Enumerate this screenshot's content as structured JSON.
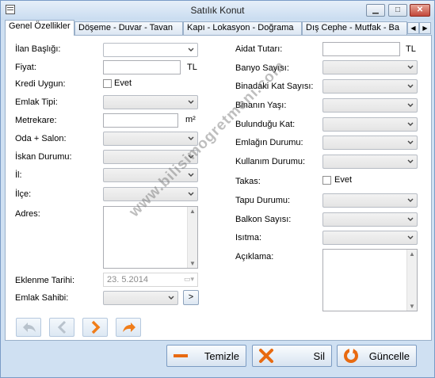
{
  "window": {
    "title": "Satılık Konut"
  },
  "tabs": [
    {
      "label": "Genel Özellikler"
    },
    {
      "label": "Döşeme - Duvar - Tavan"
    },
    {
      "label": "Kapı - Lokasyon - Doğrama"
    },
    {
      "label": "Dış Cephe - Mutfak - Ba"
    }
  ],
  "left": {
    "ilan_basligi": "İlan Başlığı:",
    "fiyat": "Fiyat:",
    "fiyat_unit": "TL",
    "kredi": "Kredi Uygun:",
    "kredi_check": "Evet",
    "emlak_tipi": "Emlak Tipi:",
    "metrekare": "Metrekare:",
    "metrekare_unit": "m²",
    "oda_salon": "Oda + Salon:",
    "iskan": "İskan Durumu:",
    "il": "İl:",
    "ilce": "İlçe:",
    "adres": "Adres:",
    "eklenme": "Eklenme Tarihi:",
    "eklenme_value": "23.  5.2014",
    "emlak_sahibi": "Emlak Sahibi:",
    "emlak_sahibi_btn": ">"
  },
  "right": {
    "aidat": "Aidat Tutarı:",
    "aidat_unit": "TL",
    "banyo": "Banyo Sayısı:",
    "kat_sayisi": "Binadaki Kat Sayısı:",
    "bina_yasi": "Binanın Yaşı:",
    "bulundugu_kat": "Bulunduğu Kat:",
    "emlak_durumu": "Emlağın Durumu:",
    "kullanim": "Kullanım Durumu:",
    "takas": "Takas:",
    "takas_check": "Evet",
    "tapu": "Tapu Durumu:",
    "balkon": "Balkon Sayısı:",
    "isitma": "Isıtma:",
    "aciklama": "Açıklama:"
  },
  "buttons": {
    "temizle": "Temizle",
    "sil": "Sil",
    "guncelle": "Güncelle"
  },
  "watermark": "www.bilisimogretmeni.com",
  "colors": {
    "nav_active": "#f07d1a",
    "nav_disabled": "#b8c2cc",
    "delete": "#e86a10"
  }
}
